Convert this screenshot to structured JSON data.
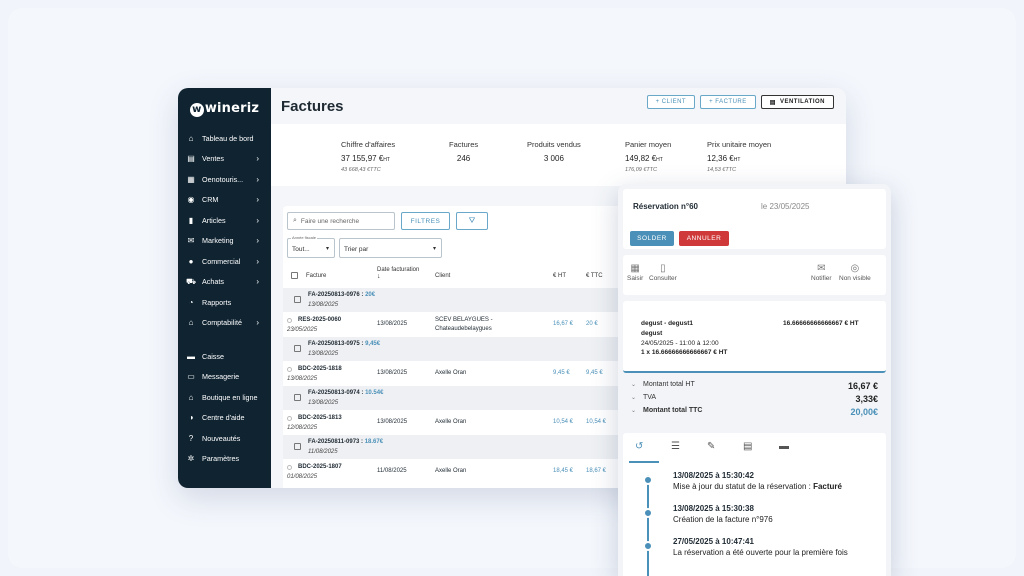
{
  "brand": "wineriz",
  "sidebar": {
    "items": [
      {
        "icon": "home-icon",
        "glyph": "⌂",
        "label": "Tableau de bord",
        "chev": false
      },
      {
        "icon": "receipt-icon",
        "glyph": "▤",
        "label": "Ventes",
        "chev": true
      },
      {
        "icon": "calendar-icon",
        "glyph": "▦",
        "label": "Oenotouris...",
        "chev": true
      },
      {
        "icon": "users-icon",
        "glyph": "◉",
        "label": "CRM",
        "chev": true
      },
      {
        "icon": "bottle-icon",
        "glyph": "▮",
        "label": "Articles",
        "chev": true
      },
      {
        "icon": "mail-icon",
        "glyph": "✉",
        "label": "Marketing",
        "chev": true
      },
      {
        "icon": "user-icon",
        "glyph": "●",
        "label": "Commercial",
        "chev": true
      },
      {
        "icon": "cart-icon",
        "glyph": "⛟",
        "label": "Achats",
        "chev": true
      },
      {
        "icon": "chart-icon",
        "glyph": "◔",
        "label": "Rapports",
        "chev": false
      },
      {
        "icon": "bank-icon",
        "glyph": "⌂",
        "label": "Comptabilité",
        "chev": true
      }
    ],
    "bottom": [
      {
        "icon": "cash-register-icon",
        "glyph": "▬",
        "label": "Caisse"
      },
      {
        "icon": "chat-icon",
        "glyph": "▭",
        "label": "Messagerie"
      },
      {
        "icon": "store-icon",
        "glyph": "⌂",
        "label": "Boutique en ligne"
      },
      {
        "icon": "help-icon",
        "glyph": "◑",
        "label": "Centre d'aide"
      },
      {
        "icon": "question-icon",
        "glyph": "?",
        "label": "Nouveautés"
      },
      {
        "icon": "gear-icon",
        "glyph": "✲",
        "label": "Paramètres"
      }
    ]
  },
  "header": {
    "title": "Factures",
    "btn_client": "+ CLIENT",
    "btn_facture": "+ FACTURE",
    "btn_ventilation": "VENTILATION"
  },
  "stats": [
    {
      "label": "Chiffre d'affaires",
      "value": "37 155,97 €",
      "unit": "HT",
      "sub": "43 668,43 €TTC"
    },
    {
      "label": "Factures",
      "value": "246",
      "unit": "",
      "sub": ""
    },
    {
      "label": "Produits vendus",
      "value": "3 006",
      "unit": "",
      "sub": ""
    },
    {
      "label": "Panier moyen",
      "value": "149,82 €",
      "unit": "HT",
      "sub": "176,09 €TTC"
    },
    {
      "label": "Prix unitaire moyen",
      "value": "12,36 €",
      "unit": "HT",
      "sub": "14,53 €TTC"
    }
  ],
  "filters": {
    "search_placeholder": "Faire une recherche",
    "filters_label": "FILTRES",
    "year_caption": "Année fiscale",
    "year_value": "Tout...",
    "sort_value": "Trier par"
  },
  "table": {
    "headers": {
      "facture": "Facture",
      "date": "Date facturation",
      "client": "Client",
      "ht": "€ HT",
      "ttc": "€ TTC"
    },
    "rows": [
      {
        "kind": "grp",
        "ref": "FA-20250813-0976",
        "amount": "20€",
        "date": "13/08/2025"
      },
      {
        "kind": "item",
        "ref": "RES-2025-0060",
        "sub": "23/05/2025",
        "date": "13/08/2025",
        "client": "SCEV BELAYGUES -",
        "client2": "Chateaudebelaygues",
        "ht": "16,67 €",
        "ttc": "20 €"
      },
      {
        "kind": "grp",
        "ref": "FA-20250813-0975",
        "amount": "9,45€",
        "date": "13/08/2025"
      },
      {
        "kind": "item",
        "ref": "BDC-2025-1818",
        "sub": "13/08/2025",
        "date": "13/08/2025",
        "client": "Axelle Oran",
        "client2": "",
        "ht": "9,45 €",
        "ttc": "9,45 €"
      },
      {
        "kind": "grp",
        "ref": "FA-20250813-0974",
        "amount": "10.54€",
        "date": "13/08/2025"
      },
      {
        "kind": "item",
        "ref": "BDC-2025-1813",
        "sub": "12/08/2025",
        "date": "13/08/2025",
        "client": "Axelle Oran",
        "client2": "",
        "ht": "10,54 €",
        "ttc": "10,54 €"
      },
      {
        "kind": "grp",
        "ref": "FA-20250811-0973",
        "amount": "18.67€",
        "date": "11/08/2025"
      },
      {
        "kind": "item",
        "ref": "BDC-2025-1807",
        "sub": "01/08/2025",
        "date": "11/08/2025",
        "client": "Axelle Oran",
        "client2": "",
        "ht": "18,45 €",
        "ttc": "18,67 €"
      }
    ]
  },
  "reservation": {
    "title": "Réservation n°60",
    "date": "le 23/05/2025",
    "btn_solder": "SOLDER",
    "btn_annuler": "ANNULER",
    "actions": {
      "saisir": "Saisir",
      "consulter": "Consulter",
      "notifier": "Notifier",
      "non_visible": "Non visible"
    },
    "line": {
      "name": "degust - degust1",
      "price": "16.66666666666667 € HT",
      "sub": "degust",
      "when": "24/05/2025 - 11:00 à 12:00",
      "qty": "1 x 16.66666666666667 € HT"
    },
    "totals": [
      {
        "label": "Montant total HT",
        "value": "16,67 €",
        "bold": false,
        "color": "#222"
      },
      {
        "label": "TVA",
        "value": "3,33€",
        "bold": false,
        "color": "#222"
      },
      {
        "label": "Montant total TTC",
        "value": "20,00€",
        "bold": true,
        "color": "#4a90b8"
      }
    ],
    "events": [
      {
        "time": "13/08/2025 à 15:30:42",
        "desc": "Mise à jour du statut de la réservation : ",
        "desc_bold": "Facturé"
      },
      {
        "time": "13/08/2025 à 15:30:38",
        "desc": "Création de la facture n°976",
        "desc_bold": ""
      },
      {
        "time": "27/05/2025 à 10:47:41",
        "desc": "La réservation a été ouverte pour la première fois",
        "desc_bold": ""
      }
    ]
  },
  "colors": {
    "sidebar": "#0f2331",
    "accent": "#4a90b8",
    "danger": "#d0393a"
  }
}
